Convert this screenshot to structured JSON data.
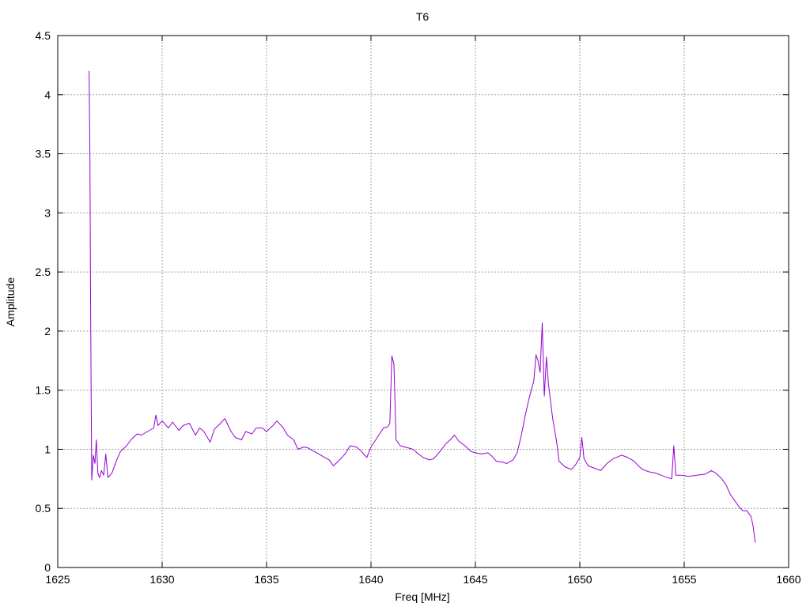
{
  "chart_data": {
    "type": "line",
    "title": "T6",
    "xlabel": "Freq [MHz]",
    "ylabel": "Amplitude",
    "xlim": [
      1625,
      1660
    ],
    "ylim": [
      0,
      4.5
    ],
    "xticks": [
      "1625",
      "1630",
      "1635",
      "1640",
      "1645",
      "1650",
      "1655",
      "1660"
    ],
    "yticks": [
      "0",
      "0.5",
      "1",
      "1.5",
      "2",
      "2.5",
      "3",
      "3.5",
      "4",
      "4.5"
    ],
    "grid": true,
    "legend": "none",
    "series": [
      {
        "color": "#9400d3",
        "points": [
          [
            1626.5,
            4.2
          ],
          [
            1626.54,
            3.45
          ],
          [
            1626.57,
            2.4
          ],
          [
            1626.6,
            1.5
          ],
          [
            1626.63,
            0.74
          ],
          [
            1626.7,
            0.95
          ],
          [
            1626.78,
            0.88
          ],
          [
            1626.85,
            1.08
          ],
          [
            1626.92,
            0.8
          ],
          [
            1627.0,
            0.76
          ],
          [
            1627.1,
            0.82
          ],
          [
            1627.2,
            0.78
          ],
          [
            1627.3,
            0.96
          ],
          [
            1627.4,
            0.76
          ],
          [
            1627.5,
            0.78
          ],
          [
            1627.6,
            0.8
          ],
          [
            1627.8,
            0.9
          ],
          [
            1628.0,
            0.98
          ],
          [
            1628.3,
            1.03
          ],
          [
            1628.5,
            1.08
          ],
          [
            1628.8,
            1.13
          ],
          [
            1629.0,
            1.12
          ],
          [
            1629.3,
            1.15
          ],
          [
            1629.6,
            1.18
          ],
          [
            1629.7,
            1.29
          ],
          [
            1629.8,
            1.2
          ],
          [
            1630.0,
            1.24
          ],
          [
            1630.3,
            1.18
          ],
          [
            1630.5,
            1.23
          ],
          [
            1630.8,
            1.16
          ],
          [
            1631.0,
            1.2
          ],
          [
            1631.3,
            1.22
          ],
          [
            1631.6,
            1.12
          ],
          [
            1631.8,
            1.18
          ],
          [
            1632.0,
            1.15
          ],
          [
            1632.3,
            1.06
          ],
          [
            1632.5,
            1.17
          ],
          [
            1632.8,
            1.22
          ],
          [
            1633.0,
            1.26
          ],
          [
            1633.3,
            1.15
          ],
          [
            1633.5,
            1.1
          ],
          [
            1633.8,
            1.08
          ],
          [
            1634.0,
            1.15
          ],
          [
            1634.3,
            1.13
          ],
          [
            1634.5,
            1.18
          ],
          [
            1634.8,
            1.18
          ],
          [
            1635.0,
            1.15
          ],
          [
            1635.3,
            1.2
          ],
          [
            1635.5,
            1.24
          ],
          [
            1635.8,
            1.18
          ],
          [
            1636.0,
            1.12
          ],
          [
            1636.3,
            1.08
          ],
          [
            1636.5,
            1.0
          ],
          [
            1636.8,
            1.02
          ],
          [
            1637.0,
            1.01
          ],
          [
            1637.3,
            0.98
          ],
          [
            1637.5,
            0.96
          ],
          [
            1637.8,
            0.93
          ],
          [
            1638.0,
            0.91
          ],
          [
            1638.2,
            0.86
          ],
          [
            1638.5,
            0.91
          ],
          [
            1638.8,
            0.97
          ],
          [
            1639.0,
            1.03
          ],
          [
            1639.3,
            1.02
          ],
          [
            1639.5,
            0.99
          ],
          [
            1639.7,
            0.95
          ],
          [
            1639.8,
            0.93
          ],
          [
            1640.0,
            1.02
          ],
          [
            1640.3,
            1.1
          ],
          [
            1640.6,
            1.18
          ],
          [
            1640.8,
            1.19
          ],
          [
            1640.9,
            1.22
          ],
          [
            1641.0,
            1.79
          ],
          [
            1641.1,
            1.72
          ],
          [
            1641.2,
            1.08
          ],
          [
            1641.4,
            1.03
          ],
          [
            1641.8,
            1.01
          ],
          [
            1642.0,
            1.0
          ],
          [
            1642.2,
            0.97
          ],
          [
            1642.5,
            0.93
          ],
          [
            1642.8,
            0.91
          ],
          [
            1643.0,
            0.92
          ],
          [
            1643.3,
            0.98
          ],
          [
            1643.6,
            1.05
          ],
          [
            1643.8,
            1.08
          ],
          [
            1644.0,
            1.12
          ],
          [
            1644.2,
            1.07
          ],
          [
            1644.5,
            1.03
          ],
          [
            1644.8,
            0.98
          ],
          [
            1645.0,
            0.97
          ],
          [
            1645.3,
            0.96
          ],
          [
            1645.6,
            0.97
          ],
          [
            1645.8,
            0.94
          ],
          [
            1646.0,
            0.9
          ],
          [
            1646.3,
            0.89
          ],
          [
            1646.5,
            0.88
          ],
          [
            1646.8,
            0.91
          ],
          [
            1647.0,
            0.97
          ],
          [
            1647.2,
            1.12
          ],
          [
            1647.4,
            1.3
          ],
          [
            1647.6,
            1.45
          ],
          [
            1647.8,
            1.58
          ],
          [
            1647.9,
            1.8
          ],
          [
            1648.0,
            1.75
          ],
          [
            1648.1,
            1.65
          ],
          [
            1648.2,
            2.07
          ],
          [
            1648.3,
            1.45
          ],
          [
            1648.4,
            1.78
          ],
          [
            1648.5,
            1.55
          ],
          [
            1648.7,
            1.26
          ],
          [
            1648.9,
            1.05
          ],
          [
            1649.0,
            0.9
          ],
          [
            1649.3,
            0.85
          ],
          [
            1649.6,
            0.83
          ],
          [
            1649.8,
            0.87
          ],
          [
            1650.0,
            0.93
          ],
          [
            1650.1,
            1.1
          ],
          [
            1650.2,
            0.92
          ],
          [
            1650.4,
            0.86
          ],
          [
            1650.7,
            0.84
          ],
          [
            1651.0,
            0.82
          ],
          [
            1651.3,
            0.88
          ],
          [
            1651.6,
            0.92
          ],
          [
            1652.0,
            0.95
          ],
          [
            1652.3,
            0.93
          ],
          [
            1652.6,
            0.9
          ],
          [
            1652.8,
            0.86
          ],
          [
            1653.0,
            0.83
          ],
          [
            1653.3,
            0.81
          ],
          [
            1653.6,
            0.8
          ],
          [
            1653.9,
            0.78
          ],
          [
            1654.2,
            0.76
          ],
          [
            1654.4,
            0.75
          ],
          [
            1654.5,
            1.03
          ],
          [
            1654.6,
            0.78
          ],
          [
            1654.9,
            0.78
          ],
          [
            1655.2,
            0.77
          ],
          [
            1655.6,
            0.78
          ],
          [
            1656.0,
            0.79
          ],
          [
            1656.3,
            0.82
          ],
          [
            1656.5,
            0.8
          ],
          [
            1656.8,
            0.75
          ],
          [
            1657.0,
            0.7
          ],
          [
            1657.2,
            0.62
          ],
          [
            1657.4,
            0.57
          ],
          [
            1657.6,
            0.52
          ],
          [
            1657.8,
            0.48
          ],
          [
            1658.0,
            0.48
          ],
          [
            1658.2,
            0.43
          ],
          [
            1658.3,
            0.35
          ],
          [
            1658.4,
            0.21
          ]
        ]
      }
    ]
  }
}
